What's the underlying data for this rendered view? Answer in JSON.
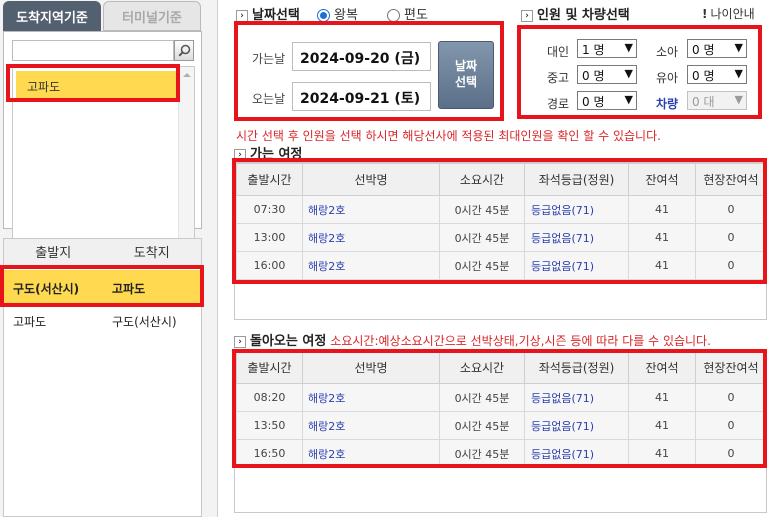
{
  "left": {
    "tabs": [
      {
        "label": "도착지역기준",
        "active": true
      },
      {
        "label": "터미널기준",
        "active": false
      }
    ],
    "search": {
      "value": "",
      "placeholder": ""
    },
    "list_items": [
      {
        "label": "고파도",
        "selected": true
      }
    ],
    "route_headers": {
      "departure": "출발지",
      "arrival": "도착지"
    },
    "routes": [
      {
        "from": "구도(서산시)",
        "to": "고파도",
        "selected": true
      },
      {
        "from": "고파도",
        "to": "구도(서산시)",
        "selected": false
      }
    ]
  },
  "date_section": {
    "title": "날짜선택",
    "trip_types": [
      {
        "label": "왕복",
        "checked": true
      },
      {
        "label": "편도",
        "checked": false
      }
    ],
    "depart_label": "가는날",
    "depart_date": "2024-09-20 (금)",
    "return_label": "오는날",
    "return_date": "2024-09-21 (토)",
    "select_button_line1": "날짜",
    "select_button_line2": "선택"
  },
  "pax_section": {
    "title": "인원 및 차량선택",
    "age_guide": "나이안내",
    "rows": [
      {
        "left_label": "대인",
        "left_value": "1 명",
        "right_label": "소아",
        "right_value": "0 명"
      },
      {
        "left_label": "중고",
        "left_value": "0 명",
        "right_label": "유아",
        "right_value": "0 명"
      },
      {
        "left_label": "경로",
        "left_value": "0 명",
        "right_label": "차량",
        "right_value": "0 대"
      }
    ]
  },
  "notice_text": "시간 선택 후 인원을 선택 하시면 해당선사에 적용된 최대인원을 확인 할 수 있습니다.",
  "outbound": {
    "title": "가는 여정",
    "headers": [
      "출발시간",
      "선박명",
      "소요시간",
      "좌석등급(정원)",
      "잔여석",
      "현장잔여석"
    ],
    "rows": [
      [
        "07:30",
        "해랑2호",
        "0시간 45분",
        "등급없음(71)",
        "41",
        "0"
      ],
      [
        "13:00",
        "해랑2호",
        "0시간 45분",
        "등급없음(71)",
        "41",
        "0"
      ],
      [
        "16:00",
        "해랑2호",
        "0시간 45분",
        "등급없음(71)",
        "41",
        "0"
      ]
    ]
  },
  "inbound": {
    "title": "돌아오는 여정",
    "note": "소요시간:예상소요시간으로 선박상태,기상,시즌 등에 따라 다를 수 있습니다.",
    "headers": [
      "출발시간",
      "선박명",
      "소요시간",
      "좌석등급(정원)",
      "잔여석",
      "현장잔여석"
    ],
    "rows": [
      [
        "08:20",
        "해랑2호",
        "0시간 45분",
        "등급없음(71)",
        "41",
        "0"
      ],
      [
        "13:50",
        "해랑2호",
        "0시간 45분",
        "등급없음(71)",
        "41",
        "0"
      ],
      [
        "16:50",
        "해랑2호",
        "0시간 45분",
        "등급없음(71)",
        "41",
        "0"
      ]
    ]
  },
  "colors": {
    "highlight": "#ffd94f",
    "red_outline": "#e8141c",
    "tab_active": "#52606f",
    "link": "#2a3fae",
    "notice": "#d9262a"
  }
}
